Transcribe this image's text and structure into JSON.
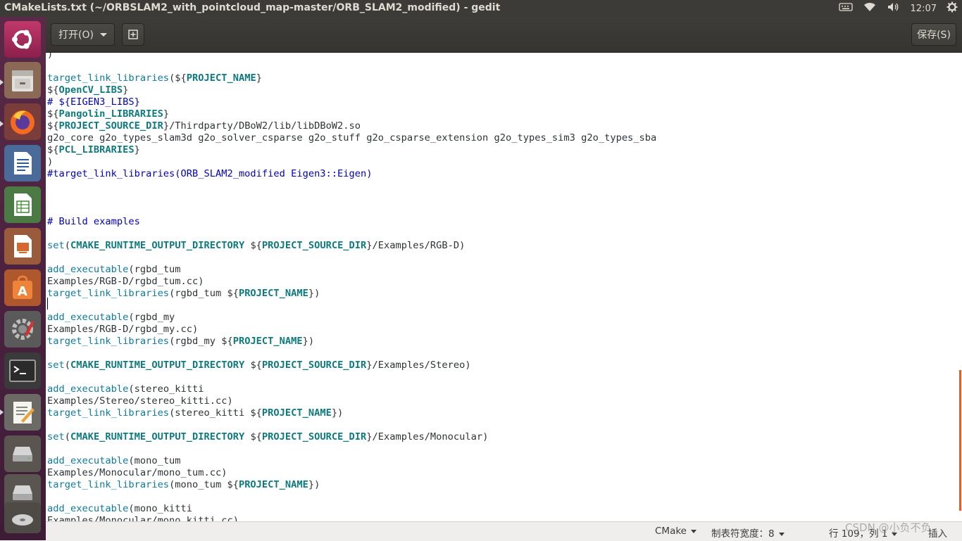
{
  "window": {
    "title": "CMakeLists.txt (~/ORBSLAM2_with_pointcloud_map-master/ORB_SLAM2_modified) - gedit"
  },
  "tray": {
    "clock": "12:07"
  },
  "toolbar": {
    "open_label": "打开(O)",
    "save_label": "保存(S)"
  },
  "launcher": {
    "items": [
      "ubuntu-logo-icon",
      "file-cabinet-icon",
      "firefox-icon",
      "writer-document-icon",
      "calc-spreadsheet-icon",
      "impress-presentation-icon",
      "software-center-icon",
      "system-settings-icon",
      "terminal-icon",
      "text-editor-icon",
      "drive-icon",
      "drive-icon",
      "disc-icon"
    ]
  },
  "editor": {
    "lines": [
      [
        {
          "t": ")",
          "c": "p"
        }
      ],
      [],
      [
        {
          "t": "target_link_libraries",
          "c": "kw"
        },
        {
          "t": "(${",
          "c": "p"
        },
        {
          "t": "PROJECT_NAME",
          "c": "var"
        },
        {
          "t": "}",
          "c": "p"
        }
      ],
      [
        {
          "t": "${",
          "c": "p"
        },
        {
          "t": "OpenCV_LIBS",
          "c": "var"
        },
        {
          "t": "}",
          "c": "p"
        }
      ],
      [
        {
          "t": "# ${EIGEN3_LIBS}",
          "c": "cm"
        }
      ],
      [
        {
          "t": "${",
          "c": "p"
        },
        {
          "t": "Pangolin_LIBRARIES",
          "c": "var"
        },
        {
          "t": "}",
          "c": "p"
        }
      ],
      [
        {
          "t": "${",
          "c": "p"
        },
        {
          "t": "PROJECT_SOURCE_DIR",
          "c": "var"
        },
        {
          "t": "}/Thirdparty/DBoW2/lib/libDBoW2.so",
          "c": "p"
        }
      ],
      [
        {
          "t": "g2o_core g2o_types_slam3d g2o_solver_csparse g2o_stuff g2o_csparse_extension g2o_types_sim3 g2o_types_sba",
          "c": "p"
        }
      ],
      [
        {
          "t": "${",
          "c": "p"
        },
        {
          "t": "PCL_LIBRARIES",
          "c": "var"
        },
        {
          "t": "}",
          "c": "p"
        }
      ],
      [
        {
          "t": ")",
          "c": "p"
        }
      ],
      [
        {
          "t": "#target_link_libraries(ORB_SLAM2_modified Eigen3::Eigen)",
          "c": "cm"
        }
      ],
      [],
      [],
      [],
      [
        {
          "t": "# Build examples",
          "c": "cm"
        }
      ],
      [],
      [
        {
          "t": "set",
          "c": "kw"
        },
        {
          "t": "(",
          "c": "p"
        },
        {
          "t": "CMAKE_RUNTIME_OUTPUT_DIRECTORY",
          "c": "var"
        },
        {
          "t": " ${",
          "c": "p"
        },
        {
          "t": "PROJECT_SOURCE_DIR",
          "c": "var"
        },
        {
          "t": "}/Examples/RGB-D)",
          "c": "p"
        }
      ],
      [],
      [
        {
          "t": "add_executable",
          "c": "kw"
        },
        {
          "t": "(rgbd_tum",
          "c": "p"
        }
      ],
      [
        {
          "t": "Examples/RGB-D/rgbd_tum.cc)",
          "c": "p"
        }
      ],
      [
        {
          "t": "target_link_libraries",
          "c": "kw"
        },
        {
          "t": "(rgbd_tum ${",
          "c": "p"
        },
        {
          "t": "PROJECT_NAME",
          "c": "var"
        },
        {
          "t": "})",
          "c": "p"
        }
      ],
      [],
      [
        {
          "t": "add_executable",
          "c": "kw"
        },
        {
          "t": "(rgbd_my",
          "c": "p"
        }
      ],
      [
        {
          "t": "Examples/RGB-D/rgbd_my.cc)",
          "c": "p"
        }
      ],
      [
        {
          "t": "target_link_libraries",
          "c": "kw"
        },
        {
          "t": "(rgbd_my ${",
          "c": "p"
        },
        {
          "t": "PROJECT_NAME",
          "c": "var"
        },
        {
          "t": "})",
          "c": "p"
        }
      ],
      [],
      [
        {
          "t": "set",
          "c": "kw"
        },
        {
          "t": "(",
          "c": "p"
        },
        {
          "t": "CMAKE_RUNTIME_OUTPUT_DIRECTORY",
          "c": "var"
        },
        {
          "t": " ${",
          "c": "p"
        },
        {
          "t": "PROJECT_SOURCE_DIR",
          "c": "var"
        },
        {
          "t": "}/Examples/Stereo)",
          "c": "p"
        }
      ],
      [],
      [
        {
          "t": "add_executable",
          "c": "kw"
        },
        {
          "t": "(stereo_kitti",
          "c": "p"
        }
      ],
      [
        {
          "t": "Examples/Stereo/stereo_kitti.cc)",
          "c": "p"
        }
      ],
      [
        {
          "t": "target_link_libraries",
          "c": "kw"
        },
        {
          "t": "(stereo_kitti ${",
          "c": "p"
        },
        {
          "t": "PROJECT_NAME",
          "c": "var"
        },
        {
          "t": "})",
          "c": "p"
        }
      ],
      [],
      [
        {
          "t": "set",
          "c": "kw"
        },
        {
          "t": "(",
          "c": "p"
        },
        {
          "t": "CMAKE_RUNTIME_OUTPUT_DIRECTORY",
          "c": "var"
        },
        {
          "t": " ${",
          "c": "p"
        },
        {
          "t": "PROJECT_SOURCE_DIR",
          "c": "var"
        },
        {
          "t": "}/Examples/Monocular)",
          "c": "p"
        }
      ],
      [],
      [
        {
          "t": "add_executable",
          "c": "kw"
        },
        {
          "t": "(mono_tum",
          "c": "p"
        }
      ],
      [
        {
          "t": "Examples/Monocular/mono_tum.cc)",
          "c": "p"
        }
      ],
      [
        {
          "t": "target_link_libraries",
          "c": "kw"
        },
        {
          "t": "(mono_tum ${",
          "c": "p"
        },
        {
          "t": "PROJECT_NAME",
          "c": "var"
        },
        {
          "t": "})",
          "c": "p"
        }
      ],
      [],
      [
        {
          "t": "add_executable",
          "c": "kw"
        },
        {
          "t": "(mono_kitti",
          "c": "p"
        }
      ],
      [
        {
          "t": "Examples/Monocular/mono_kitti.cc)",
          "c": "p"
        }
      ]
    ]
  },
  "statusbar": {
    "language": "CMake",
    "tab_width": "制表符宽度：8",
    "position": "行 109，列 1",
    "mode": "插入"
  },
  "watermark": "CSDN @小负不负"
}
